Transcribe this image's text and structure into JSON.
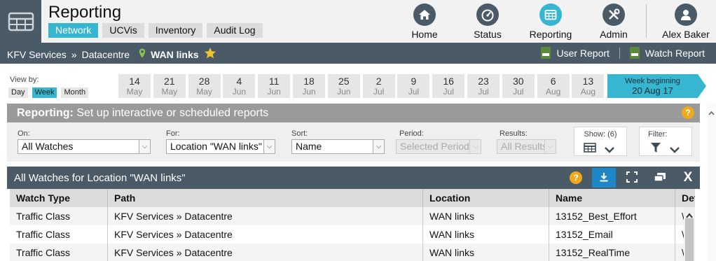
{
  "header": {
    "title": "Reporting",
    "subtabs": [
      "Network",
      "UCVis",
      "Inventory",
      "Audit Log"
    ],
    "active_subtab": "Network",
    "nav": [
      {
        "label": "Home",
        "icon": "home-icon"
      },
      {
        "label": "Status",
        "icon": "gauge-icon"
      },
      {
        "label": "Reporting",
        "icon": "calendar-icon"
      },
      {
        "label": "Admin",
        "icon": "tools-icon"
      },
      {
        "label": "Alex Baker",
        "icon": "user-icon"
      }
    ],
    "active_nav": "Reporting"
  },
  "breadcrumb": {
    "items": [
      "KFV Services",
      "Datacentre"
    ],
    "separator": "»",
    "current": "WAN links",
    "user_report": "User Report",
    "watch_report": "Watch Report"
  },
  "dates": {
    "view_by_label": "View by:",
    "view_options": [
      "Day",
      "Week",
      "Month"
    ],
    "active_view": "Week",
    "weeks": [
      {
        "day": "14",
        "month": "May"
      },
      {
        "day": "21",
        "month": "May"
      },
      {
        "day": "28",
        "month": "May"
      },
      {
        "day": "4",
        "month": "Jun"
      },
      {
        "day": "11",
        "month": "Jun"
      },
      {
        "day": "18",
        "month": "Jun"
      },
      {
        "day": "25",
        "month": "Jun"
      },
      {
        "day": "2",
        "month": "Jul"
      },
      {
        "day": "9",
        "month": "Jul"
      },
      {
        "day": "16",
        "month": "Jul"
      },
      {
        "day": "23",
        "month": "Jul"
      },
      {
        "day": "30",
        "month": "Jul"
      },
      {
        "day": "6",
        "month": "Aug"
      },
      {
        "day": "13",
        "month": "Aug"
      }
    ],
    "current_week_label": "Week beginning",
    "current_week": "20 Aug 17"
  },
  "panel": {
    "title_bold": "Reporting:",
    "title_rest": "Set up interactive or scheduled reports",
    "help": "?",
    "on_label": "On:",
    "on_value": "All Watches",
    "for_label": "For:",
    "for_value": "Location \"WAN links\"",
    "sort_label": "Sort:",
    "sort_value": "Name",
    "period_label": "Period:",
    "period_value": "Selected Period",
    "results_label": "Results:",
    "results_value": "All Results",
    "show_label": "Show: (6)",
    "filter_label": "Filter:"
  },
  "results": {
    "title": "All Watches for Location \"WAN links\"",
    "help": "?",
    "close": "X",
    "columns": [
      "Watch Type",
      "Path",
      "Location",
      "Name",
      "Det"
    ],
    "rows": [
      [
        "Traffic Class",
        "KFV Services » Datacentre",
        "WAN links",
        "13152_Best_Effort",
        "\\"
      ],
      [
        "Traffic Class",
        "KFV Services » Datacentre",
        "WAN links",
        "13152_Email",
        "\\"
      ],
      [
        "Traffic Class",
        "KFV Services » Datacentre",
        "WAN links",
        "13152_RealTime",
        "\\"
      ]
    ]
  },
  "colors": {
    "accent": "#37b6d2",
    "dark_bar": "#4a5a66",
    "help_orange": "#f0a81c",
    "download_blue": "#1e88c6",
    "star": "#f2c230"
  }
}
